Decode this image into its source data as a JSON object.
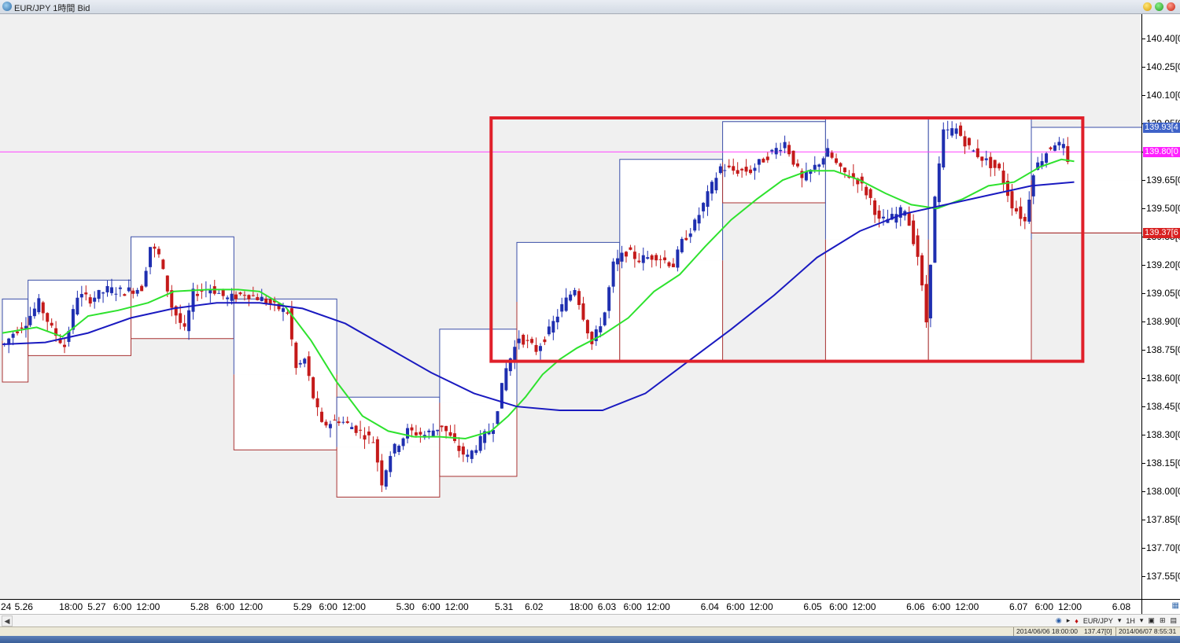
{
  "window": {
    "title": "EUR/JPY 1時間 Bid"
  },
  "price_axis": {
    "min": 137.43,
    "max": 140.53,
    "ticks": [
      "140.40[0",
      "140.25[0",
      "140.10[0",
      "139.95[0",
      "139.80[0",
      "139.65[0",
      "139.50[0",
      "139.35[0",
      "139.20[0",
      "139.05[0",
      "138.90[0",
      "138.75[0",
      "138.60[0",
      "138.45[0",
      "138.30[0",
      "138.15[0",
      "138.00[0",
      "137.85[0",
      "137.70[0",
      "137.55[0"
    ],
    "current_ask": {
      "value": 139.93,
      "label": "139.93[4"
    },
    "current_bid": {
      "value": 139.8,
      "label": "139.80[0"
    },
    "low_marker": {
      "value": 139.37,
      "label": "139.37[6"
    }
  },
  "time_axis": {
    "labels": [
      {
        "text": "24",
        "bar": 0
      },
      {
        "text": "5.26",
        "bar": 5
      },
      {
        "text": "18:00",
        "bar": 16
      },
      {
        "text": "5.27",
        "bar": 22
      },
      {
        "text": "6:00",
        "bar": 28
      },
      {
        "text": "12:00",
        "bar": 34
      },
      {
        "text": "5.28",
        "bar": 46
      },
      {
        "text": "6:00",
        "bar": 52
      },
      {
        "text": "12:00",
        "bar": 58
      },
      {
        "text": "5.29",
        "bar": 70
      },
      {
        "text": "6:00",
        "bar": 76
      },
      {
        "text": "12:00",
        "bar": 82
      },
      {
        "text": "5.30",
        "bar": 94
      },
      {
        "text": "6:00",
        "bar": 100
      },
      {
        "text": "12:00",
        "bar": 106
      },
      {
        "text": "5.31",
        "bar": 117
      },
      {
        "text": "6.02",
        "bar": 124
      },
      {
        "text": "18:00",
        "bar": 135
      },
      {
        "text": "6.03",
        "bar": 141
      },
      {
        "text": "6:00",
        "bar": 147
      },
      {
        "text": "12:00",
        "bar": 153
      },
      {
        "text": "6.04",
        "bar": 165
      },
      {
        "text": "6:00",
        "bar": 171
      },
      {
        "text": "12:00",
        "bar": 177
      },
      {
        "text": "6.05",
        "bar": 189
      },
      {
        "text": "6:00",
        "bar": 195
      },
      {
        "text": "12:00",
        "bar": 201
      },
      {
        "text": "6.06",
        "bar": 213
      },
      {
        "text": "6:00",
        "bar": 219
      },
      {
        "text": "12:00",
        "bar": 225
      },
      {
        "text": "6.07",
        "bar": 237
      },
      {
        "text": "6:00",
        "bar": 243
      },
      {
        "text": "12:00",
        "bar": 249
      },
      {
        "text": "6.08",
        "bar": 261
      }
    ]
  },
  "chart_data": {
    "type": "candlestick",
    "symbol": "EUR/JPY",
    "timeframe": "1時間",
    "price_side": "Bid",
    "bar_count": 267,
    "ylim": [
      137.43,
      140.53
    ],
    "grid": false,
    "colors": {
      "up": "#1f2fb0",
      "down": "#c41a1a",
      "background": "#f0f0f0",
      "ma_fast": "#2ee22e",
      "ma_slow": "#1a1ac0",
      "high_box": "#3a4ea8",
      "low_box": "#a83232",
      "bid_line": "#ff40ff",
      "highlight": "#e0202a"
    },
    "candles_anchors": [
      [
        0,
        138.78
      ],
      [
        2,
        138.84
      ],
      [
        5,
        138.9
      ],
      [
        8,
        139.0
      ],
      [
        11,
        138.86
      ],
      [
        14,
        138.77
      ],
      [
        17,
        139.04
      ],
      [
        20,
        139.02
      ],
      [
        24,
        139.07
      ],
      [
        28,
        139.06
      ],
      [
        32,
        139.08
      ],
      [
        34,
        139.3
      ],
      [
        36,
        139.25
      ],
      [
        39,
        138.98
      ],
      [
        42,
        138.85
      ],
      [
        44,
        139.05
      ],
      [
        48,
        139.08
      ],
      [
        52,
        139.02
      ],
      [
        56,
        139.05
      ],
      [
        60,
        139.02
      ],
      [
        63,
        138.98
      ],
      [
        66,
        138.95
      ],
      [
        68,
        138.65
      ],
      [
        70,
        138.7
      ],
      [
        72,
        138.5
      ],
      [
        74,
        138.35
      ],
      [
        78,
        138.38
      ],
      [
        82,
        138.33
      ],
      [
        86,
        138.27
      ],
      [
        88,
        138.05
      ],
      [
        90,
        138.2
      ],
      [
        94,
        138.32
      ],
      [
        98,
        138.3
      ],
      [
        102,
        138.35
      ],
      [
        106,
        138.22
      ],
      [
        108,
        138.18
      ],
      [
        111,
        138.27
      ],
      [
        114,
        138.35
      ],
      [
        117,
        138.65
      ],
      [
        120,
        138.82
      ],
      [
        124,
        138.75
      ],
      [
        127,
        138.85
      ],
      [
        130,
        138.98
      ],
      [
        133,
        139.08
      ],
      [
        137,
        138.78
      ],
      [
        140,
        138.95
      ],
      [
        142,
        139.2
      ],
      [
        145,
        139.27
      ],
      [
        148,
        139.23
      ],
      [
        152,
        139.25
      ],
      [
        156,
        139.2
      ],
      [
        158,
        139.32
      ],
      [
        161,
        139.42
      ],
      [
        164,
        139.57
      ],
      [
        167,
        139.72
      ],
      [
        170,
        139.7
      ],
      [
        174,
        139.7
      ],
      [
        178,
        139.78
      ],
      [
        182,
        139.85
      ],
      [
        186,
        139.65
      ],
      [
        189,
        139.72
      ],
      [
        192,
        139.8
      ],
      [
        195,
        139.7
      ],
      [
        199,
        139.65
      ],
      [
        202,
        139.55
      ],
      [
        204,
        139.43
      ],
      [
        207,
        139.45
      ],
      [
        210,
        139.5
      ],
      [
        213,
        139.25
      ],
      [
        215,
        138.9
      ],
      [
        217,
        139.55
      ],
      [
        219,
        139.9
      ],
      [
        222,
        139.92
      ],
      [
        225,
        139.82
      ],
      [
        229,
        139.75
      ],
      [
        232,
        139.7
      ],
      [
        235,
        139.52
      ],
      [
        238,
        139.43
      ],
      [
        240,
        139.7
      ],
      [
        243,
        139.8
      ],
      [
        245,
        139.85
      ],
      [
        247,
        139.82
      ],
      [
        248,
        139.73
      ]
    ],
    "series": [
      {
        "name": "",
        "kind": "moving-average-fast",
        "points": [
          [
            0,
            138.84
          ],
          [
            8,
            138.87
          ],
          [
            14,
            138.82
          ],
          [
            20,
            138.93
          ],
          [
            27,
            138.96
          ],
          [
            34,
            139.0
          ],
          [
            40,
            139.06
          ],
          [
            48,
            139.07
          ],
          [
            55,
            139.07
          ],
          [
            60,
            139.06
          ],
          [
            66,
            138.98
          ],
          [
            72,
            138.8
          ],
          [
            78,
            138.58
          ],
          [
            84,
            138.4
          ],
          [
            90,
            138.32
          ],
          [
            96,
            138.29
          ],
          [
            102,
            138.29
          ],
          [
            108,
            138.28
          ],
          [
            114,
            138.32
          ],
          [
            118,
            138.4
          ],
          [
            122,
            138.5
          ],
          [
            126,
            138.62
          ],
          [
            130,
            138.7
          ],
          [
            134,
            138.76
          ],
          [
            140,
            138.83
          ],
          [
            146,
            138.92
          ],
          [
            152,
            139.06
          ],
          [
            158,
            139.15
          ],
          [
            164,
            139.3
          ],
          [
            170,
            139.44
          ],
          [
            176,
            139.55
          ],
          [
            182,
            139.65
          ],
          [
            188,
            139.7
          ],
          [
            194,
            139.7
          ],
          [
            200,
            139.65
          ],
          [
            206,
            139.58
          ],
          [
            212,
            139.52
          ],
          [
            218,
            139.5
          ],
          [
            224,
            139.55
          ],
          [
            230,
            139.62
          ],
          [
            236,
            139.64
          ],
          [
            242,
            139.72
          ],
          [
            247,
            139.76
          ],
          [
            250,
            139.75
          ]
        ]
      },
      {
        "name": "",
        "kind": "moving-average-slow",
        "points": [
          [
            0,
            138.78
          ],
          [
            10,
            138.79
          ],
          [
            20,
            138.84
          ],
          [
            30,
            138.92
          ],
          [
            40,
            138.97
          ],
          [
            50,
            139.0
          ],
          [
            60,
            139.0
          ],
          [
            70,
            138.97
          ],
          [
            80,
            138.89
          ],
          [
            90,
            138.76
          ],
          [
            100,
            138.63
          ],
          [
            110,
            138.52
          ],
          [
            120,
            138.45
          ],
          [
            130,
            138.43
          ],
          [
            140,
            138.43
          ],
          [
            150,
            138.52
          ],
          [
            160,
            138.69
          ],
          [
            170,
            138.86
          ],
          [
            180,
            139.04
          ],
          [
            190,
            139.24
          ],
          [
            200,
            139.38
          ],
          [
            210,
            139.47
          ],
          [
            220,
            139.52
          ],
          [
            230,
            139.57
          ],
          [
            240,
            139.62
          ],
          [
            250,
            139.64
          ]
        ]
      }
    ],
    "daily_boxes": [
      {
        "from": 0,
        "to": 6,
        "high": 139.02,
        "low": 138.58
      },
      {
        "from": 6,
        "to": 30,
        "high": 139.12,
        "low": 138.72
      },
      {
        "from": 30,
        "to": 54,
        "high": 139.35,
        "low": 138.81
      },
      {
        "from": 54,
        "to": 78,
        "high": 139.02,
        "low": 138.22
      },
      {
        "from": 78,
        "to": 102,
        "high": 138.5,
        "low": 137.97
      },
      {
        "from": 102,
        "to": 120,
        "high": 138.86,
        "low": 138.08
      },
      {
        "from": 120,
        "to": 144,
        "high": 139.32,
        "low": 138.69
      },
      {
        "from": 144,
        "to": 168,
        "high": 139.76,
        "low": 138.69
      },
      {
        "from": 168,
        "to": 192,
        "high": 139.96,
        "low": 139.53
      },
      {
        "from": 192,
        "to": 216,
        "high": 139.98,
        "low": 138.69
      },
      {
        "from": 216,
        "to": 240,
        "high": 139.98,
        "low": 138.69
      },
      {
        "from": 240,
        "to": 267,
        "high": 139.93,
        "low": 139.37
      }
    ],
    "highlight_box": {
      "from_bar": 114,
      "to_bar": 252,
      "high": 139.98,
      "low": 138.69
    }
  },
  "statusbar": {
    "datetime": "2014/06/06 18:00:00",
    "price": "137.47[0]",
    "clock": "2014/06/07 8:55:31"
  },
  "toolbar": {
    "symbol": "EUR/JPY",
    "timeframe": "1H"
  },
  "icons": [
    "app-globe-icon",
    "minimize-icon",
    "maximize-icon",
    "close-icon",
    "scroll-left-icon",
    "nav-back-icon",
    "nav-forward-icon",
    "symbol-marker-icon",
    "chart-settings-icon",
    "grid-toggle-icon",
    "layout-icon"
  ]
}
